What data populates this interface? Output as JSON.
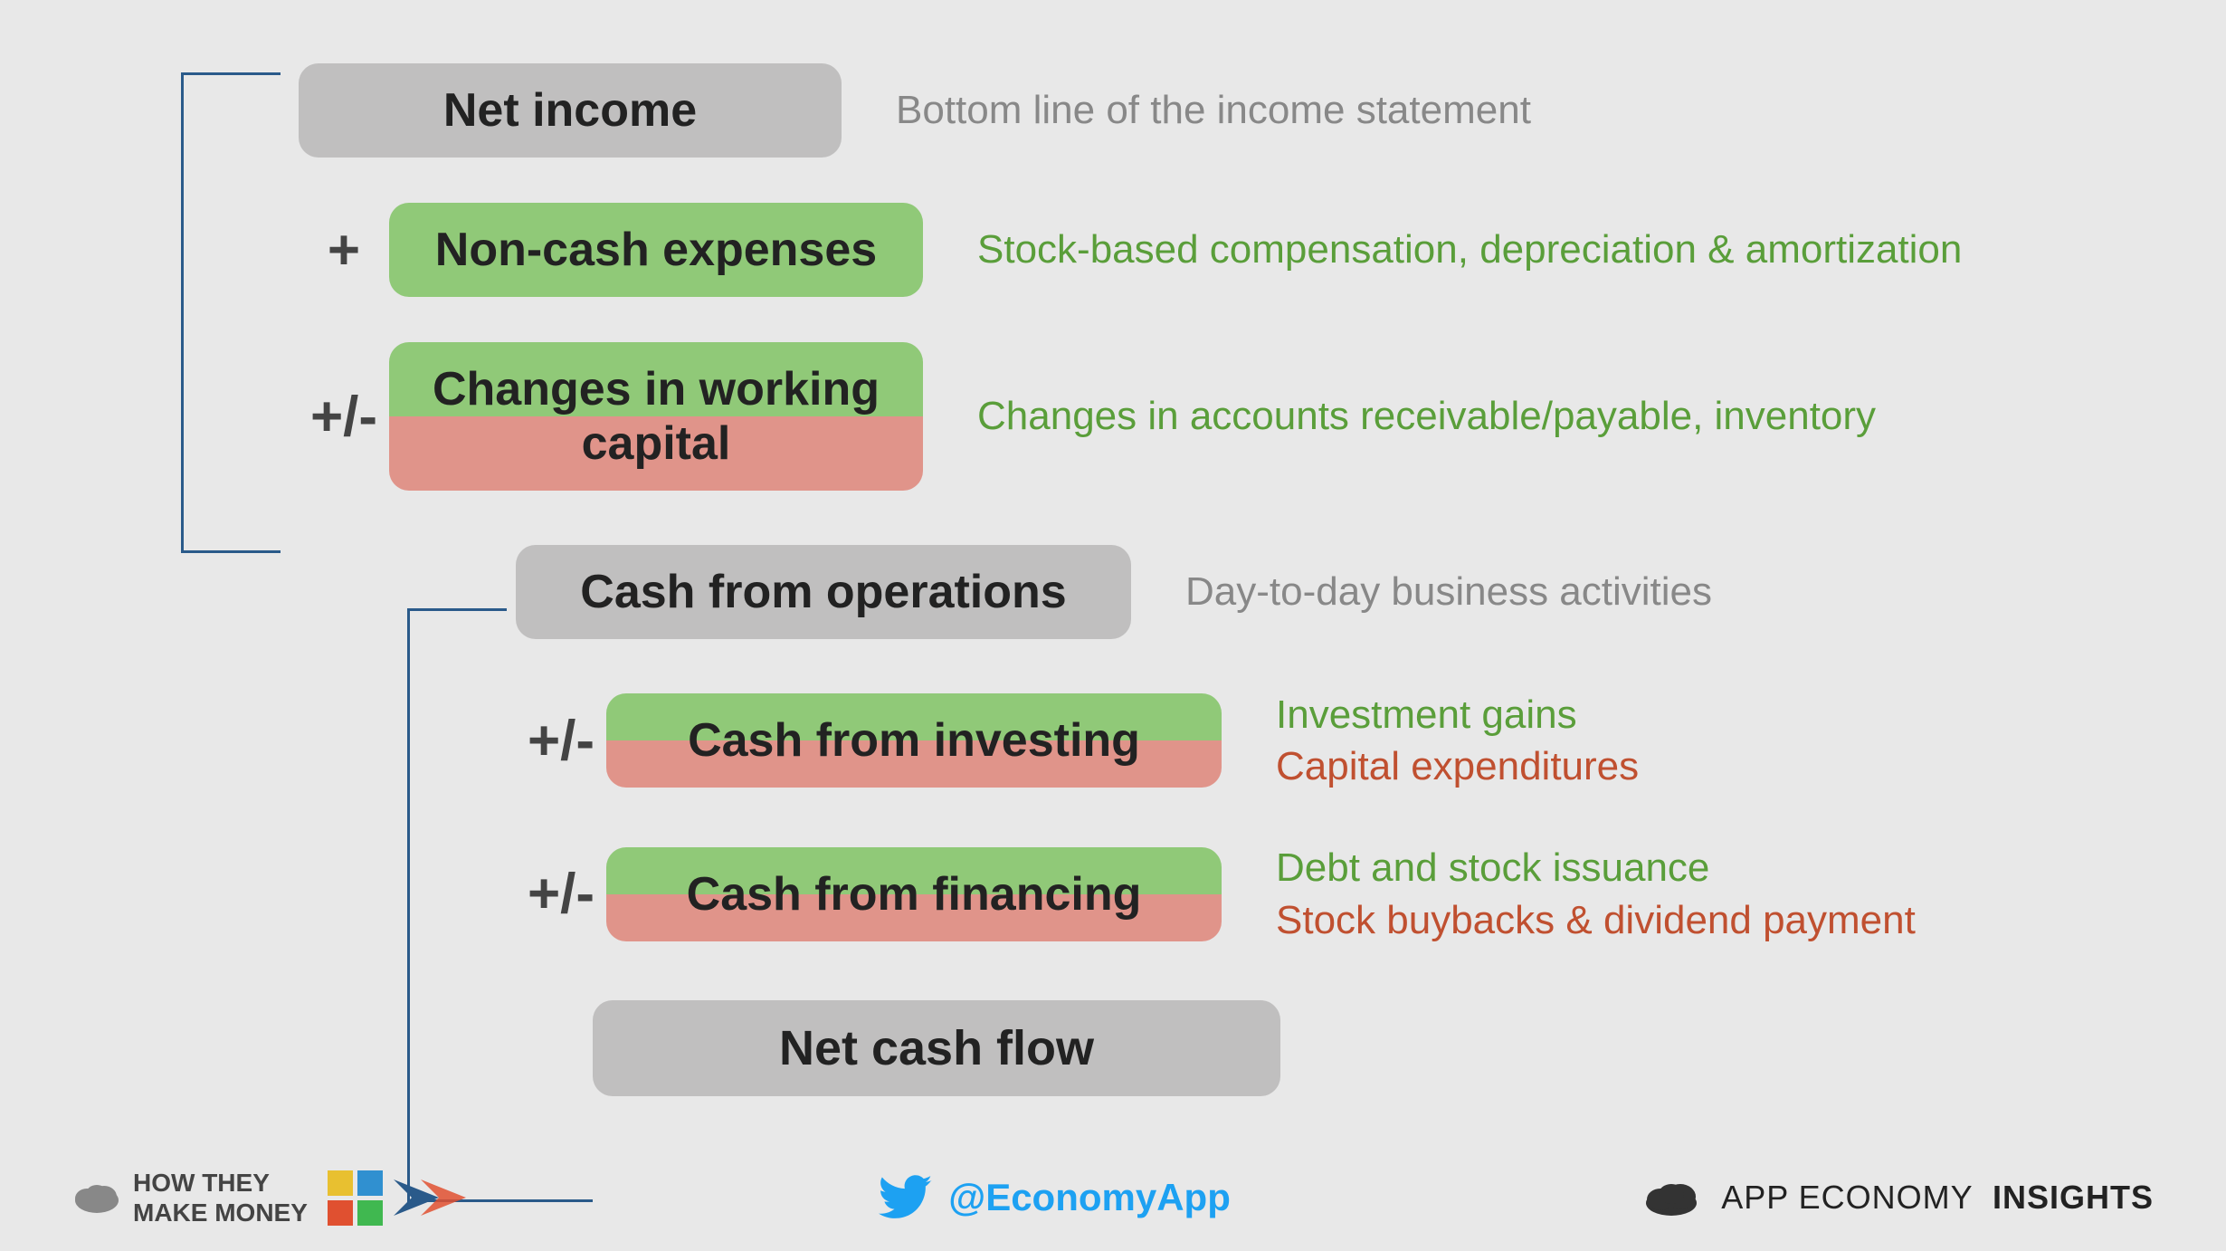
{
  "nodes": {
    "net_income": {
      "label": "Net income",
      "desc": "Bottom line of the income statement"
    },
    "non_cash": {
      "label": "Non-cash expenses",
      "desc": "Stock-based compensation, depreciation & amortization"
    },
    "working_capital": {
      "label": "Changes in working capital",
      "desc": "Changes in accounts receivable/payable, inventory"
    },
    "cash_ops": {
      "label": "Cash from operations",
      "desc": "Day-to-day business activities"
    },
    "cash_investing": {
      "label": "Cash from investing",
      "desc_green": "Investment gains",
      "desc_red": "Capital expenditures"
    },
    "cash_financing": {
      "label": "Cash from financing",
      "desc_green": "Debt and stock issuance",
      "desc_red": "Stock buybacks & dividend payment"
    },
    "net_cash": {
      "label": "Net cash flow"
    }
  },
  "operators": {
    "plus": "+",
    "plus_minus": "+/-"
  },
  "footer": {
    "brand_line1": "HOW THEY",
    "brand_line2": "MAKE MONEY",
    "twitter_handle": "@EconomyApp",
    "app_economy": "APP ECONOMY",
    "insights": "INSIGHTS"
  }
}
